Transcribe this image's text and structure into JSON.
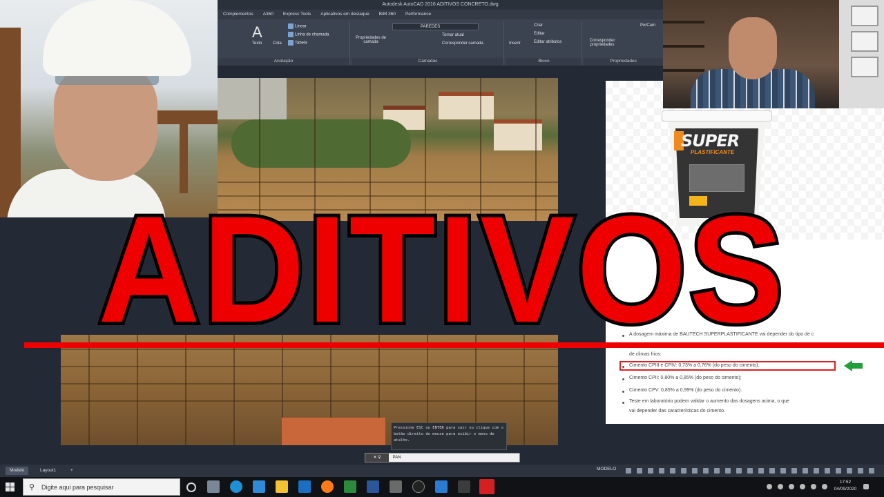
{
  "thumbnail": {
    "title": "ADITIVOS"
  },
  "autocad": {
    "window_title": "Autodesk AutoCAD 2016   ADITIVOS CONCRETO.dwg",
    "tabs": [
      "Complementos",
      "A360",
      "Express Tools",
      "Aplicativos em destaque",
      "BIM 360",
      "Performance"
    ],
    "annotation_group": {
      "label": "Anotação",
      "texto": "Texto",
      "cota": "Cota",
      "linear": "Linear",
      "linha_chamada": "Linha de chamada",
      "tabela": "Tabela"
    },
    "layers_group": {
      "label": "Camadas",
      "props": "Propriedades de camada",
      "current_layer": "PAREDES",
      "tornar_atual": "Tornar atual",
      "corresponder": "Corresponder camada"
    },
    "block_group": {
      "label": "Bloco",
      "inserir": "Inserir",
      "criar": "Criar",
      "editar": "Editar",
      "editar_atributos": "Editar atributos"
    },
    "props_group": {
      "label": "Propriedades",
      "corresponder": "Corresponder propriedades",
      "porcamada": "PorCam"
    },
    "command_tip": "Pressione ESC ou ENTER para sair ou clique com o botão direito do mouse para exibir o menu de atalho.",
    "command_mode": "PAN",
    "model_tabs": [
      "Modelo",
      "Layout1"
    ],
    "status_model": "MODELO"
  },
  "document": {
    "lines": [
      "A dosagem máxima de BAUTECH SUPERPLASTIFICANTE vai depender do tipo de c",
      "de climas frios:",
      "Cimento CPIII e CPIV:                 0,73% a 0,76% (do peso do cimento).",
      "Cimento CPII:                         0,80% a 0,85% (do peso do cimento);",
      "Cimento CPV:                          0,85% a 0,99% (do peso do cimento).",
      "Teste em laboratório podem validar o aumento das dosagens acima, o que",
      "vai depender das características do cimento."
    ]
  },
  "product": {
    "brand": "SUPER",
    "sub": "PLASTIFICANTE"
  },
  "taskbar": {
    "search_placeholder": "Digite aqui para pesquisar",
    "time": "17:52",
    "date": "04/09/2020"
  },
  "colors": {
    "title_red": "#ee0000",
    "highlight_red": "#e01e1e",
    "arrow_green": "#1fa03a"
  }
}
